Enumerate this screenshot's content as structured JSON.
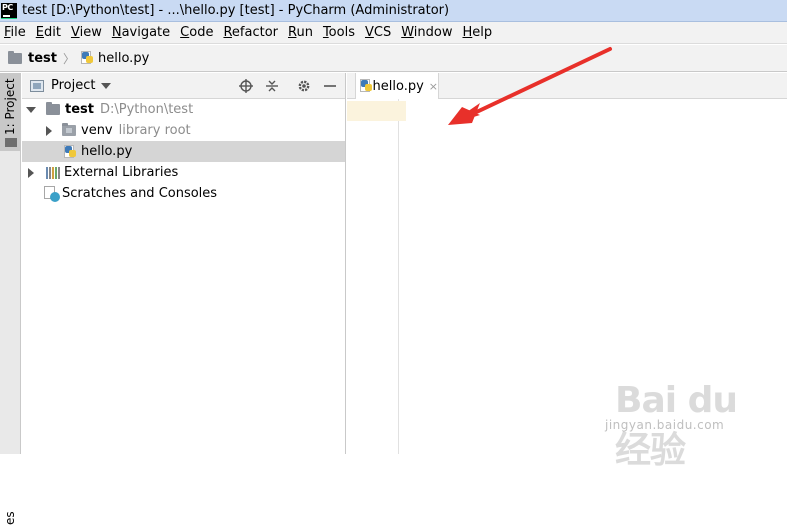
{
  "window": {
    "title": "test [D:\\Python\\test] - ...\\hello.py [test] - PyCharm (Administrator)"
  },
  "menu": [
    {
      "label": "File",
      "mnemonic": "F",
      "rest": "ile"
    },
    {
      "label": "Edit",
      "mnemonic": "E",
      "rest": "dit"
    },
    {
      "label": "View",
      "mnemonic": "V",
      "rest": "iew"
    },
    {
      "label": "Navigate",
      "mnemonic": "N",
      "rest": "avigate"
    },
    {
      "label": "Code",
      "mnemonic": "C",
      "rest": "ode"
    },
    {
      "label": "Refactor",
      "mnemonic": "R",
      "rest": "efactor"
    },
    {
      "label": "Run",
      "mnemonic": "R",
      "rest": "un"
    },
    {
      "label": "Tools",
      "mnemonic": "T",
      "rest": "ools"
    },
    {
      "label": "VCS",
      "mnemonic": "V",
      "rest": "CS"
    },
    {
      "label": "Window",
      "mnemonic": "W",
      "rest": "indow"
    },
    {
      "label": "Help",
      "mnemonic": "H",
      "rest": "elp"
    }
  ],
  "breadcrumb": {
    "project": "test",
    "file": "hello.py"
  },
  "toolstrip": {
    "project_label": "1: Project",
    "bottom_label": "es"
  },
  "project_panel": {
    "title": "Project",
    "tree": [
      {
        "label": "test",
        "hint": "D:\\Python\\test",
        "expanded": true
      },
      {
        "label": "venv",
        "hint": "library root",
        "expanded": false
      },
      {
        "label": "hello.py",
        "selected": true
      },
      {
        "label": "External Libraries",
        "expanded": false
      },
      {
        "label": "Scratches and Consoles"
      }
    ]
  },
  "editor": {
    "tab_label": "hello.py",
    "tab_close": "×"
  },
  "watermark": {
    "brand": "Bai du 经验",
    "url": "jingyan.baidu.com"
  },
  "colors": {
    "titlebar": "#c9daf3",
    "selection": "#d5d5d5",
    "current_line": "#fbf3dd",
    "annotation_arrow": "#e8302a"
  }
}
